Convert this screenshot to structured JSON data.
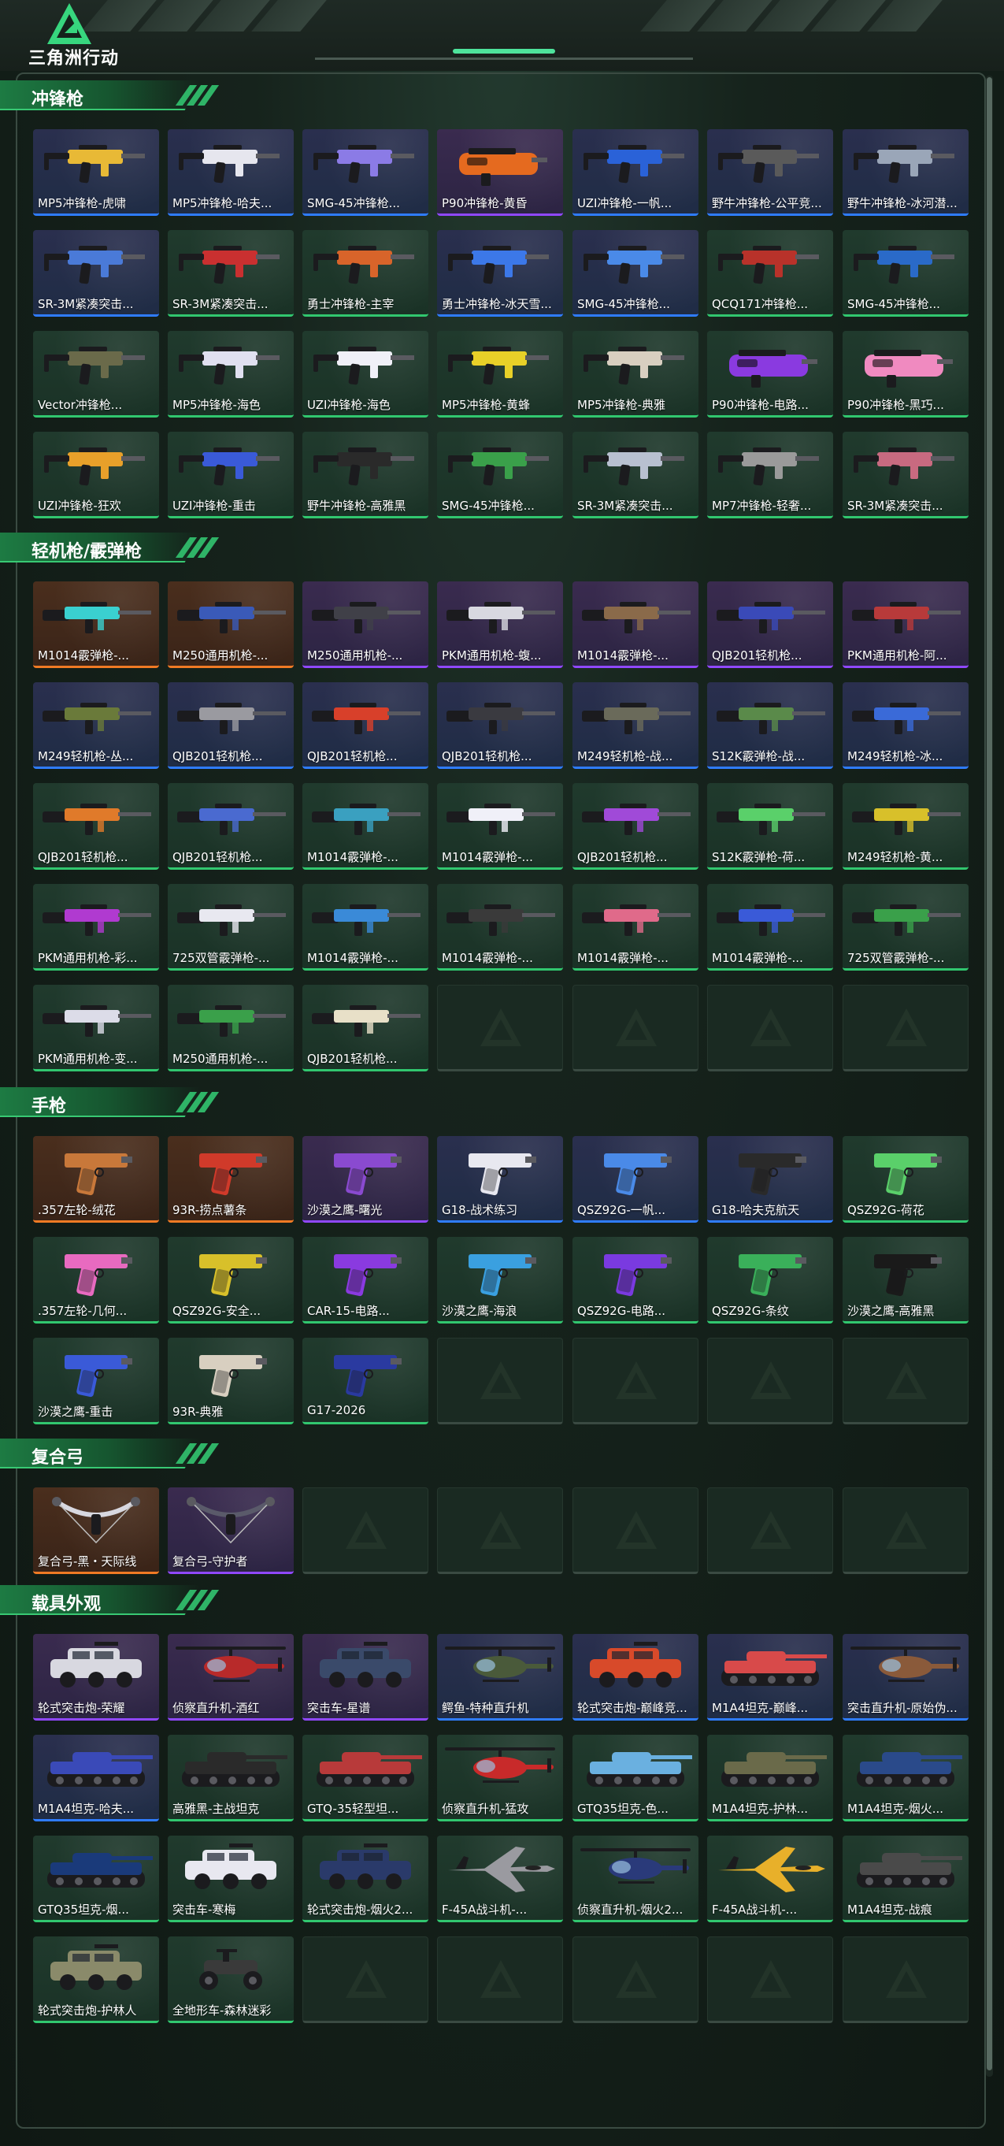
{
  "app": {
    "logo_text": "三角洲行动"
  },
  "sections": [
    {
      "id": "smg",
      "title": "冲锋枪",
      "items": [
        {
          "label": "MP5冲锋枪-虎啸",
          "rarity": "blue",
          "kind": "smg",
          "color": "#e8b936"
        },
        {
          "label": "MP5冲锋枪-哈夫...",
          "rarity": "blue",
          "kind": "smg",
          "color": "#e6e6ee"
        },
        {
          "label": "SMG-45冲锋枪...",
          "rarity": "blue",
          "kind": "smg",
          "color": "#8b7be6"
        },
        {
          "label": "P90冲锋枪-黄昏",
          "rarity": "purple",
          "kind": "p90",
          "color": "#e56a1f"
        },
        {
          "label": "UZI冲锋枪-一帆...",
          "rarity": "blue",
          "kind": "smg",
          "color": "#2a62d8"
        },
        {
          "label": "野牛冲锋枪-公平竞...",
          "rarity": "blue",
          "kind": "smg",
          "color": "#5a5a5a"
        },
        {
          "label": "野牛冲锋枪-冰河潜...",
          "rarity": "blue",
          "kind": "smg",
          "color": "#9aa6b8"
        },
        {
          "label": "SR-3M紧凑突击...",
          "rarity": "blue",
          "kind": "smg",
          "color": "#4a7ad8"
        },
        {
          "label": "SR-3M紧凑突击...",
          "rarity": "green",
          "kind": "smg",
          "color": "#c93030"
        },
        {
          "label": "勇士冲锋枪-主宰",
          "rarity": "green",
          "kind": "smg",
          "color": "#d8642a"
        },
        {
          "label": "勇士冲锋枪-冰天雪...",
          "rarity": "blue",
          "kind": "smg",
          "color": "#3c78e8"
        },
        {
          "label": "SMG-45冲锋枪...",
          "rarity": "blue",
          "kind": "smg",
          "color": "#4a8ae8"
        },
        {
          "label": "QCQ171冲锋枪...",
          "rarity": "green",
          "kind": "smg",
          "color": "#b8322a"
        },
        {
          "label": "SMG-45冲锋枪...",
          "rarity": "green",
          "kind": "smg",
          "color": "#2a6ac8"
        },
        {
          "label": "Vector冲锋枪...",
          "rarity": "green",
          "kind": "smg",
          "color": "#6a6a4a"
        },
        {
          "label": "MP5冲锋枪-海色",
          "rarity": "green",
          "kind": "smg",
          "color": "#e0e0f0"
        },
        {
          "label": "UZI冲锋枪-海色",
          "rarity": "green",
          "kind": "smg",
          "color": "#f0f0f8"
        },
        {
          "label": "MP5冲锋枪-黄蜂",
          "rarity": "green",
          "kind": "smg",
          "color": "#e8d028"
        },
        {
          "label": "MP5冲锋枪-典雅",
          "rarity": "green",
          "kind": "smg",
          "color": "#d8cfc0"
        },
        {
          "label": "P90冲锋枪-电路...",
          "rarity": "green",
          "kind": "p90",
          "color": "#8a3ae0"
        },
        {
          "label": "P90冲锋枪-黑巧...",
          "rarity": "green",
          "kind": "p90",
          "color": "#f08ac0"
        },
        {
          "label": "UZI冲锋枪-狂欢",
          "rarity": "green",
          "kind": "smg",
          "color": "#e8a02a"
        },
        {
          "label": "UZI冲锋枪-重击",
          "rarity": "green",
          "kind": "smg",
          "color": "#3a5ad8"
        },
        {
          "label": "野牛冲锋枪-高雅黑",
          "rarity": "green",
          "kind": "smg",
          "color": "#2a2a2a"
        },
        {
          "label": "SMG-45冲锋枪...",
          "rarity": "green",
          "kind": "smg",
          "color": "#3aa04a"
        },
        {
          "label": "SR-3M紧凑突击...",
          "rarity": "green",
          "kind": "smg",
          "color": "#b8c0d0"
        },
        {
          "label": "MP7冲锋枪-轻奢...",
          "rarity": "green",
          "kind": "smg",
          "color": "#9a9a9a"
        },
        {
          "label": "SR-3M紧凑突击...",
          "rarity": "green",
          "kind": "smg",
          "color": "#c86a80"
        }
      ],
      "empty_slots": 0
    },
    {
      "id": "lmg",
      "title": "轻机枪/霰弹枪",
      "items": [
        {
          "label": "M1014霰弹枪-...",
          "rarity": "gold",
          "kind": "rifle",
          "color": "#3ad0d0"
        },
        {
          "label": "M250通用机枪-...",
          "rarity": "gold",
          "kind": "rifle",
          "color": "#3a5ab8"
        },
        {
          "label": "M250通用机枪-...",
          "rarity": "purple",
          "kind": "rifle",
          "color": "#404048"
        },
        {
          "label": "PKM通用机枪-蝮...",
          "rarity": "purple",
          "kind": "rifle",
          "color": "#d8d8e0"
        },
        {
          "label": "M1014霰弹枪-...",
          "rarity": "purple",
          "kind": "rifle",
          "color": "#8a6a4a"
        },
        {
          "label": "QJB201轻机枪...",
          "rarity": "purple",
          "kind": "rifle",
          "color": "#3a4ab8"
        },
        {
          "label": "PKM通用机枪-阿...",
          "rarity": "purple",
          "kind": "rifle",
          "color": "#b83a3a"
        },
        {
          "label": "M249轻机枪-丛...",
          "rarity": "blue",
          "kind": "rifle",
          "color": "#6a7a3a"
        },
        {
          "label": "QJB201轻机枪...",
          "rarity": "blue",
          "kind": "rifle",
          "color": "#9a9aa0"
        },
        {
          "label": "QJB201轻机枪...",
          "rarity": "blue",
          "kind": "rifle",
          "color": "#d8402a"
        },
        {
          "label": "QJB201轻机枪...",
          "rarity": "blue",
          "kind": "rifle",
          "color": "#3a3a40"
        },
        {
          "label": "M249轻机枪-战...",
          "rarity": "blue",
          "kind": "rifle",
          "color": "#6a6a5a"
        },
        {
          "label": "S12K霰弹枪-战...",
          "rarity": "blue",
          "kind": "rifle",
          "color": "#5a8a4a"
        },
        {
          "label": "M249轻机枪-冰...",
          "rarity": "blue",
          "kind": "rifle",
          "color": "#3a6ad8"
        },
        {
          "label": "QJB201轻机枪...",
          "rarity": "green",
          "kind": "rifle",
          "color": "#e07a2a"
        },
        {
          "label": "QJB201轻机枪...",
          "rarity": "green",
          "kind": "rifle",
          "color": "#4a6ad0"
        },
        {
          "label": "M1014霰弹枪-...",
          "rarity": "green",
          "kind": "rifle",
          "color": "#3aa0c0"
        },
        {
          "label": "M1014霰弹枪-...",
          "rarity": "green",
          "kind": "rifle",
          "color": "#f0f0f8"
        },
        {
          "label": "QJB201轻机枪...",
          "rarity": "green",
          "kind": "rifle",
          "color": "#a04ad8"
        },
        {
          "label": "S12K霰弹枪-荷...",
          "rarity": "green",
          "kind": "rifle",
          "color": "#5ad06a"
        },
        {
          "label": "M249轻机枪-黄...",
          "rarity": "green",
          "kind": "rifle",
          "color": "#d8c02a"
        },
        {
          "label": "PKM通用机枪-彩...",
          "rarity": "green",
          "kind": "rifle",
          "color": "#b03ad0"
        },
        {
          "label": "725双管霰弹枪-...",
          "rarity": "green",
          "kind": "rifle",
          "color": "#e8e8f0"
        },
        {
          "label": "M1014霰弹枪-...",
          "rarity": "green",
          "kind": "rifle",
          "color": "#3a8ad8"
        },
        {
          "label": "M1014霰弹枪-...",
          "rarity": "green",
          "kind": "rifle",
          "color": "#3a3a3a"
        },
        {
          "label": "M1014霰弹枪-...",
          "rarity": "green",
          "kind": "rifle",
          "color": "#e06a8a"
        },
        {
          "label": "M1014霰弹枪-...",
          "rarity": "green",
          "kind": "rifle",
          "color": "#3a5ad8"
        },
        {
          "label": "725双管霰弹枪-...",
          "rarity": "green",
          "kind": "rifle",
          "color": "#3aa04a"
        },
        {
          "label": "PKM通用机枪-变...",
          "rarity": "green",
          "kind": "rifle",
          "color": "#dcdce8"
        },
        {
          "label": "M250通用机枪-...",
          "rarity": "green",
          "kind": "rifle",
          "color": "#3aa04a"
        },
        {
          "label": "QJB201轻机枪...",
          "rarity": "green",
          "kind": "rifle",
          "color": "#e8e0c8"
        }
      ],
      "empty_slots": 4
    },
    {
      "id": "pistol",
      "title": "手枪",
      "items": [
        {
          "label": ".357左轮-绒花",
          "rarity": "gold",
          "kind": "pistol",
          "color": "#c8783a"
        },
        {
          "label": "93R-捞点薯条",
          "rarity": "gold",
          "kind": "pistol",
          "color": "#d03a2a"
        },
        {
          "label": "沙漠之鹰-曙光",
          "rarity": "purple",
          "kind": "pistol",
          "color": "#8a4ad0"
        },
        {
          "label": "G18-战术练习",
          "rarity": "blue",
          "kind": "pistol",
          "color": "#e8e8f0"
        },
        {
          "label": "QSZ92G-一帆...",
          "rarity": "blue",
          "kind": "pistol",
          "color": "#4a8ae8"
        },
        {
          "label": "G18-哈夫克航天",
          "rarity": "blue",
          "kind": "pistol",
          "color": "#2a2a2a"
        },
        {
          "label": "QSZ92G-荷花",
          "rarity": "green",
          "kind": "pistol",
          "color": "#5ad06a"
        },
        {
          "label": ".357左轮-几何...",
          "rarity": "green",
          "kind": "pistol",
          "color": "#e86ac0"
        },
        {
          "label": "QSZ92G-安全...",
          "rarity": "green",
          "kind": "pistol",
          "color": "#d8c02a"
        },
        {
          "label": "CAR-15-电路...",
          "rarity": "green",
          "kind": "pistol",
          "color": "#8a3ae0"
        },
        {
          "label": "沙漠之鹰-海浪",
          "rarity": "green",
          "kind": "pistol",
          "color": "#3aa0e0"
        },
        {
          "label": "QSZ92G-电路...",
          "rarity": "green",
          "kind": "pistol",
          "color": "#7a3ae0"
        },
        {
          "label": "QSZ92G-条纹",
          "rarity": "green",
          "kind": "pistol",
          "color": "#3ab05a"
        },
        {
          "label": "沙漠之鹰-高雅黑",
          "rarity": "green",
          "kind": "pistol",
          "color": "#1a1a1a"
        },
        {
          "label": "沙漠之鹰-重击",
          "rarity": "green",
          "kind": "pistol",
          "color": "#3a5ad8"
        },
        {
          "label": "93R-典雅",
          "rarity": "green",
          "kind": "pistol",
          "color": "#d8cfc0"
        },
        {
          "label": "G17-2026",
          "rarity": "green",
          "kind": "pistol",
          "color": "#2a3aa0"
        }
      ],
      "empty_slots": 4
    },
    {
      "id": "bow",
      "title": "复合弓",
      "items": [
        {
          "label": "复合弓-黑・天际线",
          "rarity": "gold",
          "kind": "bow",
          "color": "#d8d8e0"
        },
        {
          "label": "复合弓-守护者",
          "rarity": "purple",
          "kind": "bow",
          "color": "#5a5a6a"
        }
      ],
      "empty_slots": 5
    },
    {
      "id": "vehicle",
      "title": "载具外观",
      "items": [
        {
          "label": "轮式突击炮-荣耀",
          "rarity": "purple",
          "kind": "car",
          "color": "#d8d8e0"
        },
        {
          "label": "侦察直升机-酒红",
          "rarity": "purple",
          "kind": "heli",
          "color": "#b82a2a"
        },
        {
          "label": "突击车-星谱",
          "rarity": "purple",
          "kind": "car",
          "color": "#3a4a6a"
        },
        {
          "label": "鳄鱼-特种直升机",
          "rarity": "blue",
          "kind": "heli",
          "color": "#4a5a3a"
        },
        {
          "label": "轮式突击炮-巅峰竞...",
          "rarity": "blue",
          "kind": "car",
          "color": "#d84a2a"
        },
        {
          "label": "M1A4坦克-巅峰...",
          "rarity": "blue",
          "kind": "tank",
          "color": "#d84a4a"
        },
        {
          "label": "突击直升机-原始伪...",
          "rarity": "blue",
          "kind": "heli",
          "color": "#8a5a3a"
        },
        {
          "label": "M1A4坦克-哈夫...",
          "rarity": "blue",
          "kind": "tank",
          "color": "#3a4ab8"
        },
        {
          "label": "高雅黑-主战坦克",
          "rarity": "green",
          "kind": "tank",
          "color": "#2a2a2a"
        },
        {
          "label": "GTQ-35轻型坦...",
          "rarity": "green",
          "kind": "tank",
          "color": "#b83a3a"
        },
        {
          "label": "侦察直升机-猛攻",
          "rarity": "green",
          "kind": "heli",
          "color": "#c82a2a"
        },
        {
          "label": "GTQ35坦克-色...",
          "rarity": "green",
          "kind": "tank",
          "color": "#6ab0e0"
        },
        {
          "label": "M1A4坦克-护林...",
          "rarity": "green",
          "kind": "tank",
          "color": "#6a6a4a"
        },
        {
          "label": "M1A4坦克-烟火...",
          "rarity": "green",
          "kind": "tank",
          "color": "#2a4a8a"
        },
        {
          "label": "GTQ35坦克-烟...",
          "rarity": "green",
          "kind": "tank",
          "color": "#1a3a7a"
        },
        {
          "label": "突击车-寒梅",
          "rarity": "green",
          "kind": "car",
          "color": "#e8e8f0"
        },
        {
          "label": "轮式突击炮-烟火2...",
          "rarity": "green",
          "kind": "car",
          "color": "#2a3a6a"
        },
        {
          "label": "F-45A战斗机-...",
          "rarity": "green",
          "kind": "jet",
          "color": "#9a9aa0"
        },
        {
          "label": "侦察直升机-烟火2...",
          "rarity": "green",
          "kind": "heli",
          "color": "#2a3a7a"
        },
        {
          "label": "F-45A战斗机-...",
          "rarity": "green",
          "kind": "jet",
          "color": "#e8b02a"
        },
        {
          "label": "M1A4坦克-战痕",
          "rarity": "green",
          "kind": "tank",
          "color": "#4a4a4a"
        },
        {
          "label": "轮式突击炮-护林人",
          "rarity": "green",
          "kind": "car",
          "color": "#8a8a6a"
        },
        {
          "label": "全地形车-森林迷彩",
          "rarity": "green",
          "kind": "atv",
          "color": "#3a3a3a"
        }
      ],
      "empty_slots": 5
    }
  ],
  "colors": {
    "accent": "#31c76f",
    "rarity_gold": "#f07a24",
    "rarity_purple": "#9048ff",
    "rarity_blue": "#2f7cff",
    "rarity_green": "#31c76f"
  }
}
